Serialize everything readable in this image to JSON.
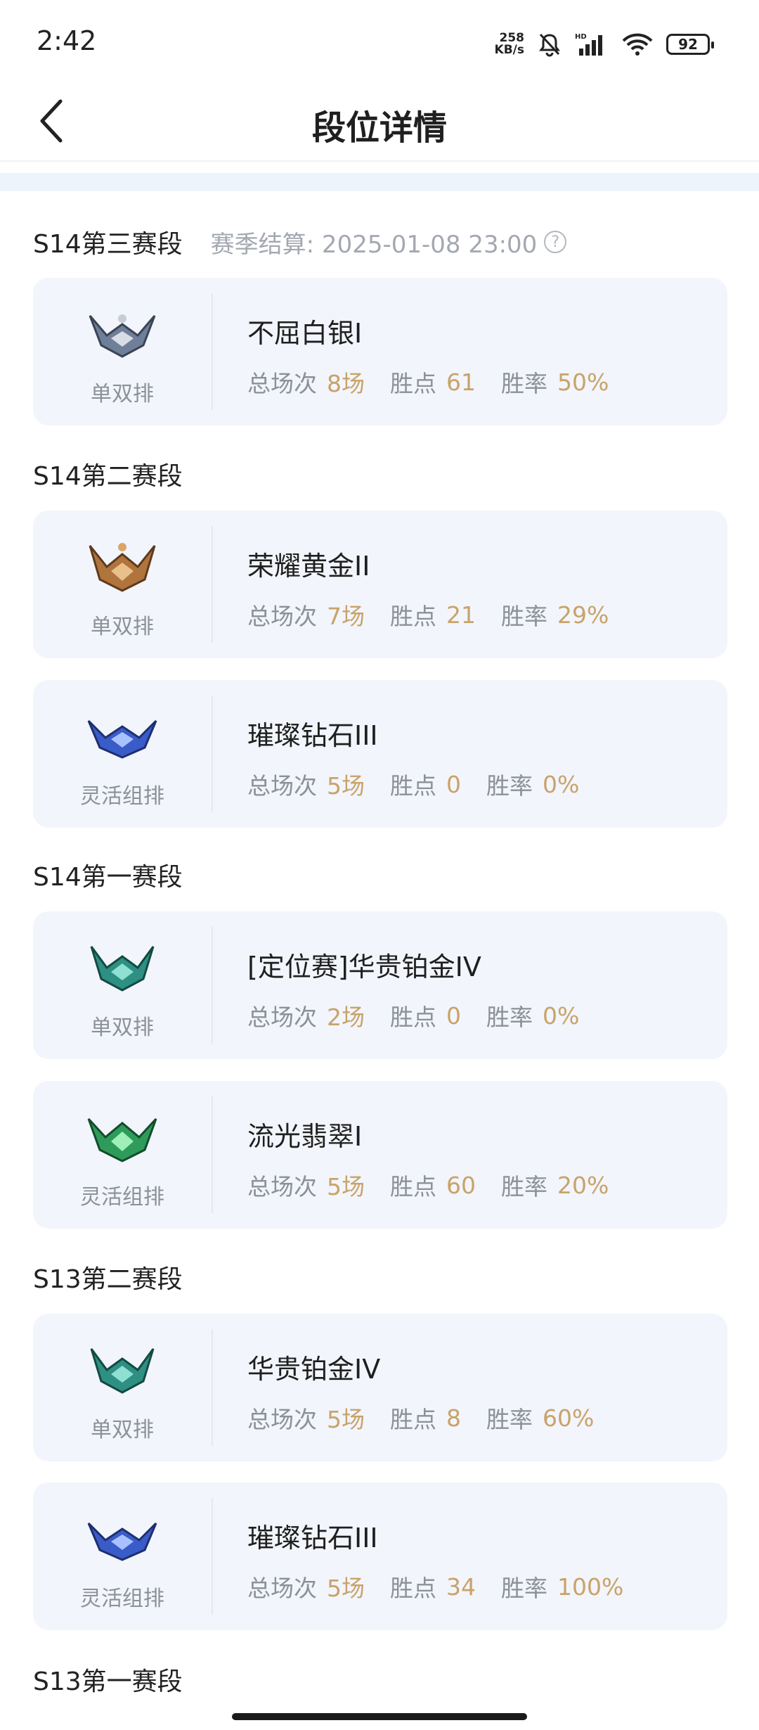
{
  "status_bar": {
    "time": "2:42",
    "net_speed_value": "258",
    "net_speed_unit": "KB/s",
    "battery": "92"
  },
  "header": {
    "title": "段位详情"
  },
  "sections": [
    {
      "title": "S14第三赛段",
      "settlement": "赛季结算: 2025-01-08 23:00",
      "cards": [
        {
          "rank": "不屈白银I",
          "queue": "单双排",
          "total_label": "总场次",
          "total": "8场",
          "points_label": "胜点",
          "points": "61",
          "winrate_label": "胜率",
          "winrate": "50%",
          "tier": "silver"
        }
      ]
    },
    {
      "title": "S14第二赛段",
      "cards": [
        {
          "rank": "荣耀黄金II",
          "queue": "单双排",
          "total_label": "总场次",
          "total": "7场",
          "points_label": "胜点",
          "points": "21",
          "winrate_label": "胜率",
          "winrate": "29%",
          "tier": "gold"
        },
        {
          "rank": "璀璨钻石III",
          "queue": "灵活组排",
          "total_label": "总场次",
          "total": "5场",
          "points_label": "胜点",
          "points": "0",
          "winrate_label": "胜率",
          "winrate": "0%",
          "tier": "diamond"
        }
      ]
    },
    {
      "title": "S14第一赛段",
      "cards": [
        {
          "rank": "[定位赛]华贵铂金IV",
          "queue": "单双排",
          "total_label": "总场次",
          "total": "2场",
          "points_label": "胜点",
          "points": "0",
          "winrate_label": "胜率",
          "winrate": "0%",
          "tier": "platinum"
        },
        {
          "rank": "流光翡翠I",
          "queue": "灵活组排",
          "total_label": "总场次",
          "total": "5场",
          "points_label": "胜点",
          "points": "60",
          "winrate_label": "胜率",
          "winrate": "20%",
          "tier": "emerald"
        }
      ]
    },
    {
      "title": "S13第二赛段",
      "cards": [
        {
          "rank": "华贵铂金IV",
          "queue": "单双排",
          "total_label": "总场次",
          "total": "5场",
          "points_label": "胜点",
          "points": "8",
          "winrate_label": "胜率",
          "winrate": "60%",
          "tier": "platinum"
        },
        {
          "rank": "璀璨钻石III",
          "queue": "灵活组排",
          "total_label": "总场次",
          "total": "5场",
          "points_label": "胜点",
          "points": "34",
          "winrate_label": "胜率",
          "winrate": "100%",
          "tier": "diamond"
        }
      ]
    },
    {
      "title": "S13第一赛段"
    }
  ],
  "colors": {
    "card_bg": "#f2f5fb",
    "value_gold": "#c9a36a",
    "muted": "#8c9099",
    "tier_silver": "#6f7f9a",
    "tier_gold": "#b0743d",
    "tier_diamond": "#3a5cc8",
    "tier_platinum": "#2e8f83",
    "tier_emerald": "#2f9b5a"
  }
}
